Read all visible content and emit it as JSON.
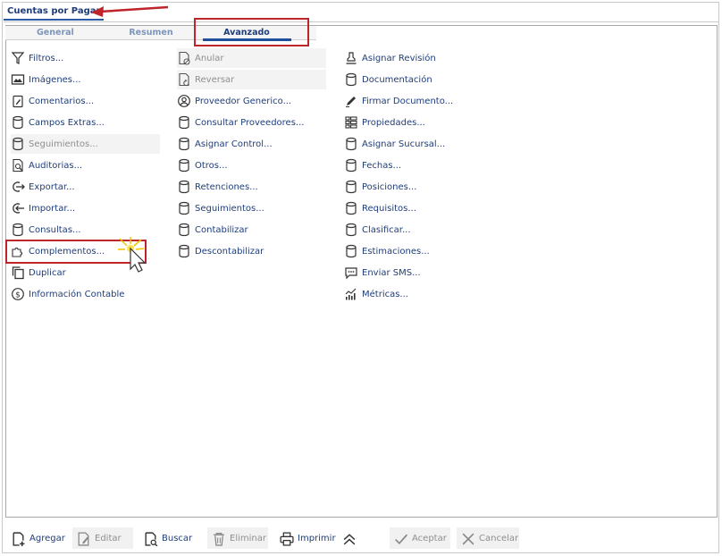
{
  "window": {
    "tab_title": "Cuentas por Pagar"
  },
  "subtabs": [
    {
      "label": "General"
    },
    {
      "label": "Resumen"
    },
    {
      "label": "Avanzado"
    }
  ],
  "columns": {
    "col1": [
      {
        "label": "Filtros...",
        "icon": "filter-icon"
      },
      {
        "label": "Imágenes...",
        "icon": "image-icon"
      },
      {
        "label": "Comentarios...",
        "icon": "clipboard-edit-icon"
      },
      {
        "label": "Campos Extras...",
        "icon": "database-icon"
      },
      {
        "label": "Seguimientos...",
        "icon": "database-icon",
        "disabled": true
      },
      {
        "label": "Auditorias...",
        "icon": "audit-search-icon"
      },
      {
        "label": "Exportar...",
        "icon": "export-icon"
      },
      {
        "label": "Importar...",
        "icon": "import-icon"
      },
      {
        "label": "Consultas...",
        "icon": "database-icon"
      },
      {
        "label": "Complementos...",
        "icon": "puzzle-icon"
      },
      {
        "label": "Duplicar",
        "icon": "copy-icon"
      },
      {
        "label": "Información Contable",
        "icon": "dollar-circle-icon"
      }
    ],
    "col2": [
      {
        "label": "Anular",
        "icon": "document-cancel-icon",
        "disabled": true
      },
      {
        "label": "Reversar",
        "icon": "document-undo-icon",
        "disabled": true
      },
      {
        "label": "Proveedor Generico...",
        "icon": "user-circle-icon"
      },
      {
        "label": "Consultar Proveedores...",
        "icon": "database-icon"
      },
      {
        "label": "Asignar Control...",
        "icon": "database-icon"
      },
      {
        "label": "Otros...",
        "icon": "database-icon"
      },
      {
        "label": "Retenciones...",
        "icon": "database-icon"
      },
      {
        "label": "Seguimientos...",
        "icon": "database-icon"
      },
      {
        "label": "Contabilizar",
        "icon": "database-icon"
      },
      {
        "label": "Descontabilizar",
        "icon": "database-icon"
      }
    ],
    "col3": [
      {
        "label": "Asignar Revisión",
        "icon": "stamp-icon"
      },
      {
        "label": "Documentación",
        "icon": "database-icon"
      },
      {
        "label": "Firmar Documento...",
        "icon": "pen-icon"
      },
      {
        "label": "Propiedades...",
        "icon": "properties-list-icon"
      },
      {
        "label": "Asignar Sucursal...",
        "icon": "database-icon"
      },
      {
        "label": "Fechas...",
        "icon": "database-icon"
      },
      {
        "label": "Posiciones...",
        "icon": "database-icon"
      },
      {
        "label": "Requisitos...",
        "icon": "database-icon"
      },
      {
        "label": "Clasificar...",
        "icon": "database-icon"
      },
      {
        "label": "Estimaciones...",
        "icon": "database-icon"
      },
      {
        "label": "Enviar SMS...",
        "icon": "sms-icon"
      },
      {
        "label": "Métricas...",
        "icon": "metrics-icon"
      }
    ]
  },
  "toolbar": [
    {
      "label": "Agregar",
      "icon": "add-document-icon"
    },
    {
      "label": "Editar",
      "icon": "edit-icon",
      "disabled": true
    },
    {
      "label": "Buscar",
      "icon": "search-document-icon"
    },
    {
      "label": "Eliminar",
      "icon": "trash-icon",
      "disabled": true
    },
    {
      "label": "Imprimir",
      "icon": "printer-icon"
    },
    {
      "label": "",
      "icon": "chevron-double-up-icon"
    },
    {
      "label": "Aceptar",
      "icon": "check-icon",
      "disabled": true
    },
    {
      "label": "Cancelar",
      "icon": "x-icon",
      "disabled": true
    }
  ],
  "colors": {
    "link": "#1f3d7a",
    "disabled": "#8f8f8f",
    "annotation": "#c0242b",
    "tab_underline": "#1f4e9c"
  }
}
